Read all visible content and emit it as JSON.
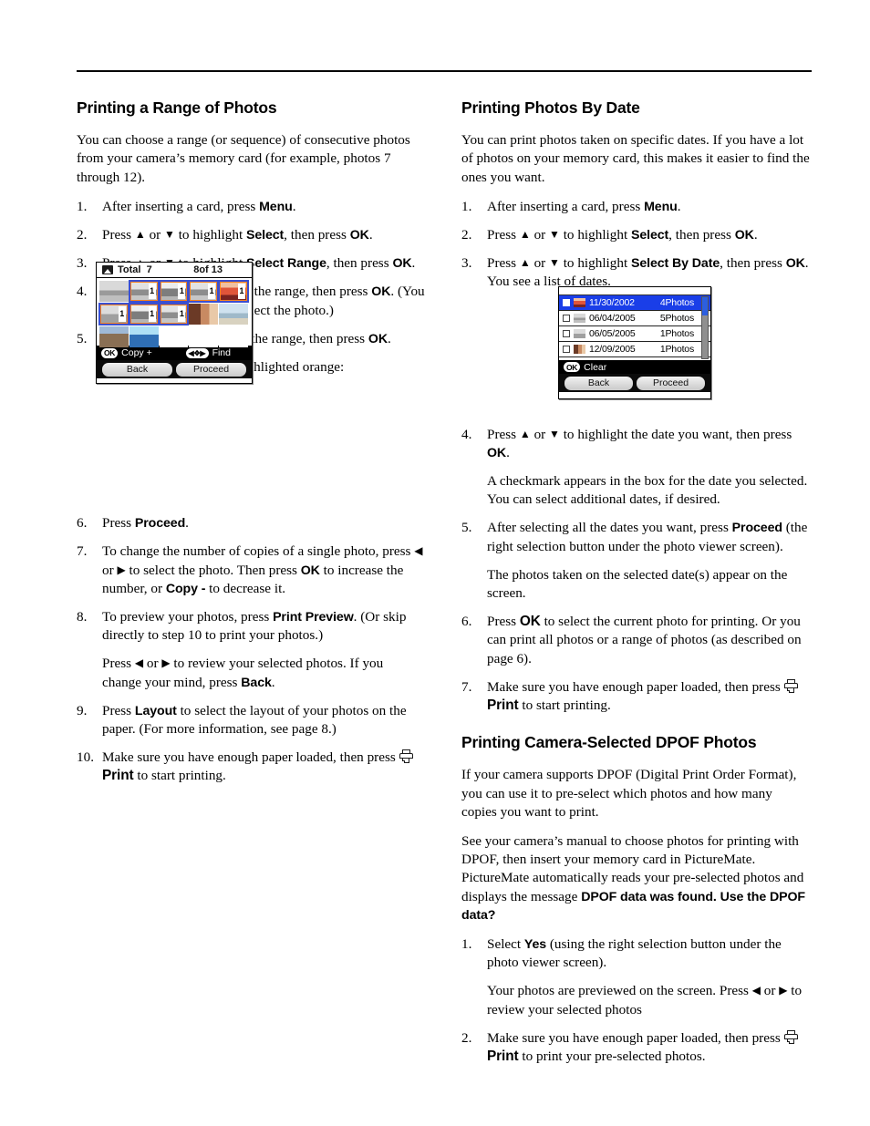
{
  "left_column": {
    "heading": "Printing a Range of Photos",
    "intro": "You can choose a range (or sequence) of consecutive photos from your camera’s memory card (for example, photos 7 through 12).",
    "steps": {
      "s1_num": "1.",
      "s1_a": "After inserting a card, press ",
      "s1_menu": "Menu",
      "s1_b": ".",
      "s2_num": "2.",
      "s2_a": "Press ",
      "s2_b": " or ",
      "s2_c": " to highlight ",
      "s2_select": "Select",
      "s2_d": ", then press ",
      "s2_ok": "OK",
      "s2_e": ".",
      "s3_num": "3.",
      "s3_a": "Press ",
      "s3_b": " or ",
      "s3_c": " to highlight ",
      "s3_range": "Select Range",
      "s3_d": ", then press ",
      "s3_ok": "OK",
      "s3_e": ".",
      "s4_num": "4.",
      "s4_a": "Highlight the first photo in the range, then press ",
      "s4_ok": "OK",
      "s4_b": ". (You can use ",
      "s4_c": ", ",
      "s4_d": ", ",
      "s4_e": ", or ",
      "s4_f": " to select the photo.)",
      "s5_num": "5.",
      "s5_a": "Highlight the last photo in the range, then press ",
      "s5_ok": "OK",
      "s5_b": ".",
      "s5_note": "The selected photos are highlighted orange:",
      "s6_num": "6.",
      "s6_a": "Press ",
      "s6_proceed": "Proceed",
      "s6_b": ".",
      "s7_num": "7.",
      "s7_a": "To change the number of copies of a single photo, press ",
      "s7_b": " or ",
      "s7_c": " to select the photo. Then press ",
      "s7_ok": "OK",
      "s7_d": " to increase the number, or ",
      "s7_copy": "Copy -",
      "s7_e": " to decrease it.",
      "s8_num": "8.",
      "s8_a": "To preview your photos, press ",
      "s8_preview": "Print Preview",
      "s8_b": ". (Or skip directly to step 10 to print your photos.)",
      "s8_sub_a": "Press ",
      "s8_sub_b": " or ",
      "s8_sub_c": " to review your selected photos. If you change your mind, press ",
      "s8_back": "Back",
      "s8_sub_d": ".",
      "s9_num": "9.",
      "s9_a": "Press ",
      "s9_layout": "Layout",
      "s9_b": " to select the layout of your photos on the paper. (For more information, see page 8.)",
      "s10_num": "10.",
      "s10_a": "Make sure you have enough paper loaded, then press ",
      "s10_print": "Print",
      "s10_b": " to start printing."
    }
  },
  "right_column": {
    "heading_date": "Printing Photos By Date",
    "intro_date": "You can print photos taken on specific dates. If you have a lot of photos on your memory card, this makes it easier to find the ones you want.",
    "steps": {
      "d1_num": "1.",
      "d1_a": "After inserting a card, press ",
      "d1_menu": "Menu",
      "d1_b": ".",
      "d2_num": "2.",
      "d2_a": "Press ",
      "d2_b": " or ",
      "d2_c": " to highlight ",
      "d2_select": "Select",
      "d2_d": ", then press ",
      "d2_ok": "OK",
      "d2_e": ".",
      "d3_num": "3.",
      "d3_a": "Press ",
      "d3_b": " or ",
      "d3_c": " to highlight ",
      "d3_bydate": "Select By Date",
      "d3_d": ", then press ",
      "d3_ok": "OK",
      "d3_e": ". You see a list of dates.",
      "d4_num": "4.",
      "d4_a": "Press ",
      "d4_b": " or ",
      "d4_c": " to highlight the date you want, then press ",
      "d4_ok": "OK",
      "d4_d": ".",
      "d4_sub": "A checkmark appears in the box for the date you selected. You can select additional dates, if desired.",
      "d5_num": "5.",
      "d5_a": "After selecting all the dates you want, press ",
      "d5_proceed": "Proceed",
      "d5_b": " (the right selection button under the photo viewer screen).",
      "d5_sub": "The photos taken on the selected date(s) appear on the screen.",
      "d6_num": "6.",
      "d6_a": "Press ",
      "d6_ok": "OK",
      "d6_b": " to select the current photo for printing. Or you can print all photos or a range of photos (as described on page 6).",
      "d7_num": "7.",
      "d7_a": "Make sure you have enough paper loaded, then press ",
      "d7_print": "Print",
      "d7_b": " to start printing."
    },
    "heading_dpof": "Printing Camera-Selected DPOF Photos",
    "dpof_p1": "If your camera supports DPOF (Digital Print Order Format), you can use it to pre-select which photos and how many copies you want to print.",
    "dpof_p2_a": "See your camera’s manual to choose photos for printing with DPOF, then insert your memory card in PictureMate. PictureMate automatically reads your pre-selected photos and displays the message ",
    "dpof_msg": "DPOF data was found. Use the DPOF data?",
    "dpof_steps": {
      "p1_num": "1.",
      "p1_a": "Select ",
      "p1_yes": "Yes",
      "p1_b": " (using the right selection button under the photo viewer screen).",
      "p1_sub_a": "Your photos are previewed on the screen. Press ",
      "p1_sub_b": " or ",
      "p1_sub_c": " to review your selected photos",
      "p2_num": "2.",
      "p2_a": "Make sure you have enough paper loaded, then press ",
      "p2_print": "Print",
      "p2_b": " to print your pre-selected photos."
    }
  },
  "lcd_photo_grid": {
    "header_total_label": "Total",
    "header_total_value": "7",
    "header_index": "8of 13",
    "status_ok_badge": "OK",
    "status_ok_label": "Copy +",
    "status_dpad_badge": "◀✥▶",
    "status_dpad_label": "Find",
    "button_back": "Back",
    "button_proceed": "Proceed",
    "cells": [
      [
        {
          "art": "im-bldg",
          "selected": false,
          "cursor": false,
          "count": ""
        },
        {
          "art": "im-bldg2",
          "selected": true,
          "cursor": true,
          "count": "1"
        },
        {
          "art": "im-stat",
          "selected": true,
          "cursor": true,
          "count": "1"
        },
        {
          "art": "im-bldg2",
          "selected": true,
          "cursor": true,
          "count": "1"
        },
        {
          "art": "im-sunset",
          "selected": true,
          "cursor": true,
          "count": "1"
        }
      ],
      [
        {
          "art": "im-road",
          "selected": true,
          "cursor": true,
          "count": "1"
        },
        {
          "art": "im-stat",
          "selected": true,
          "cursor": true,
          "count": "1"
        },
        {
          "art": "im-bldg2",
          "selected": true,
          "cursor": true,
          "count": "1"
        },
        {
          "art": "im-kids",
          "selected": false,
          "cursor": false,
          "count": ""
        },
        {
          "art": "im-beach",
          "selected": false,
          "cursor": false,
          "count": ""
        }
      ],
      [
        {
          "art": "im-rock",
          "selected": false,
          "cursor": false,
          "count": ""
        },
        {
          "art": "im-sky",
          "selected": false,
          "cursor": false,
          "count": ""
        },
        {
          "art": "im-blank",
          "selected": false,
          "cursor": false,
          "count": ""
        },
        {
          "art": "im-blank",
          "selected": false,
          "cursor": false,
          "count": ""
        },
        {
          "art": "im-blank",
          "selected": false,
          "cursor": false,
          "count": ""
        }
      ]
    ],
    "colors": {
      "selected_border": "#F58220",
      "cursor_border": "#3B4FD0"
    }
  },
  "lcd_date_list": {
    "rows": [
      {
        "date": "11/30/2002",
        "count": "4Photos",
        "active": true,
        "art": "im-sunset"
      },
      {
        "date": "06/04/2005",
        "count": "5Photos",
        "active": false,
        "art": "im-bldg"
      },
      {
        "date": "06/05/2005",
        "count": "1Photos",
        "active": false,
        "art": "im-road"
      },
      {
        "date": "12/09/2005",
        "count": "1Photos",
        "active": false,
        "art": "im-kids"
      }
    ],
    "status_ok_badge": "OK",
    "status_label": "Clear",
    "button_back": "Back",
    "button_proceed": "Proceed",
    "colors": {
      "highlight": "#1a3ee8",
      "scroll_thumb": "#2c5fe0"
    }
  }
}
